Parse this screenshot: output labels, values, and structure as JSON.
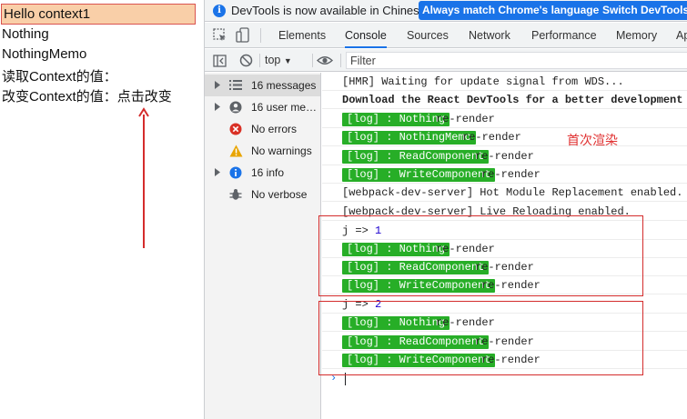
{
  "page": {
    "hello": "Hello context1",
    "nothing": "Nothing",
    "nothing_memo": "NothingMemo",
    "read_context_label": "读取Context的值：",
    "change_context_label": "改变Context的值：",
    "click_to_change": "点击改变"
  },
  "banner": {
    "message": "DevTools is now available in Chinese!",
    "match_button": "Always match Chrome's language",
    "switch_button": "Switch DevTools"
  },
  "tabs": [
    "Elements",
    "Console",
    "Sources",
    "Network",
    "Performance",
    "Memory",
    "Ap"
  ],
  "active_tab": "Console",
  "toolbar": {
    "context": "top",
    "filter_placeholder": "Filter"
  },
  "sidebar": {
    "items": [
      {
        "label": "16 messages",
        "icon": "list-icon"
      },
      {
        "label": "16 user me…",
        "icon": "user-icon"
      },
      {
        "label": "No errors",
        "icon": "error-icon"
      },
      {
        "label": "No warnings",
        "icon": "warning-icon"
      },
      {
        "label": "16 info",
        "icon": "info-icon"
      },
      {
        "label": "No verbose",
        "icon": "bug-icon"
      }
    ]
  },
  "console": {
    "lines": [
      {
        "text": "[HMR] Waiting for update signal from WDS..."
      },
      {
        "text": "Download the React DevTools for a better development"
      },
      {
        "badge": "[log] : Nothing",
        "text": "re-render"
      },
      {
        "badge": "[log] : NothingMemo",
        "text": "re-render"
      },
      {
        "badge": "[log] : ReadComponent",
        "text": "re-render"
      },
      {
        "badge": "[log] : WriteComponent",
        "text": "re-render"
      },
      {
        "text": "[webpack-dev-server] Hot Module Replacement enabled."
      },
      {
        "text": "[webpack-dev-server] Live Reloading enabled."
      },
      {
        "label": "j =>",
        "value": "1"
      },
      {
        "badge": "[log] : Nothing",
        "text": "re-render"
      },
      {
        "badge": "[log] : ReadComponent",
        "text": "re-render"
      },
      {
        "badge": "[log] : WriteComponent",
        "text": "re-render"
      },
      {
        "label": "j =>",
        "value": "2"
      },
      {
        "badge": "[log] : Nothing",
        "text": "re-render"
      },
      {
        "badge": "[log] : ReadComponent",
        "text": "re-render"
      },
      {
        "badge": "[log] : WriteComponent",
        "text": "re-render"
      }
    ],
    "first_render_note": "首次渲染",
    "prompt": "›"
  },
  "colors": {
    "badge_green": "#27ae27",
    "annotation_red": "#d42c2c",
    "accent_blue": "#1a73e8",
    "hello_bg": "#f9cfa8"
  }
}
